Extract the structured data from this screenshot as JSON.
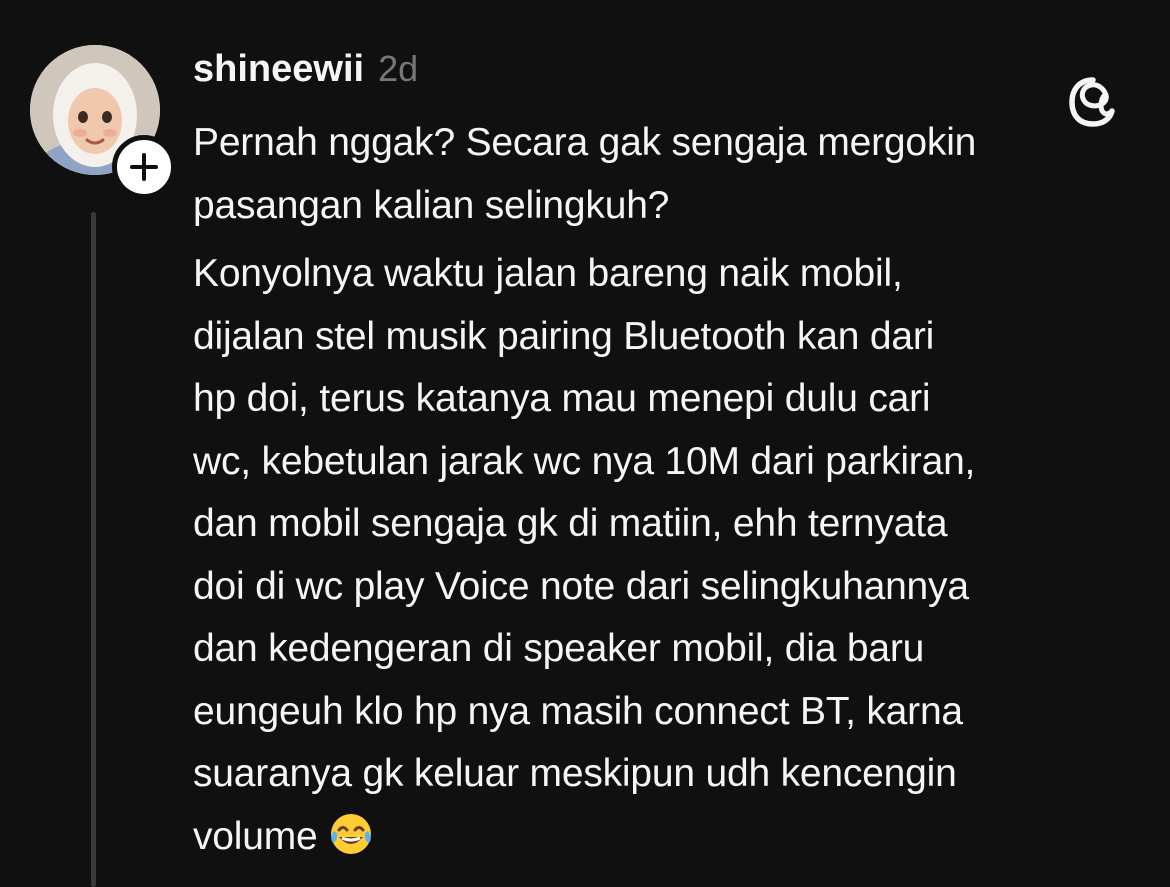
{
  "post": {
    "username": "shineewii",
    "timestamp": "2d",
    "follow_icon": "plus-icon",
    "app_icon": "threads-logo-icon",
    "paragraphs": [
      {
        "lines": [
          "Pernah nggak? Secara gak sengaja mergokin",
          "pasangan kalian selingkuh?"
        ]
      },
      {
        "lines": [
          "Konyolnya waktu jalan bareng naik mobil,",
          "dijalan stel musik pairing Bluetooth kan dari",
          "hp doi, terus katanya mau menepi dulu cari",
          "wc, kebetulan jarak wc nya 10M dari parkiran,",
          "dan mobil sengaja gk di matiin, ehh ternyata",
          "doi di wc play Voice note dari selingkuhannya",
          "dan kedengeran di speaker mobil, dia baru",
          "eungeuh klo hp nya masih connect BT, karna",
          "suaranya gk keluar meskipun udh kencengin",
          "volume"
        ],
        "trailing_emoji": "face-with-tears-of-joy-emoji"
      }
    ]
  },
  "colors": {
    "background": "#101010",
    "text_primary": "#f3f5f7",
    "text_secondary": "#777777",
    "thread_line": "#3a3a3a"
  }
}
